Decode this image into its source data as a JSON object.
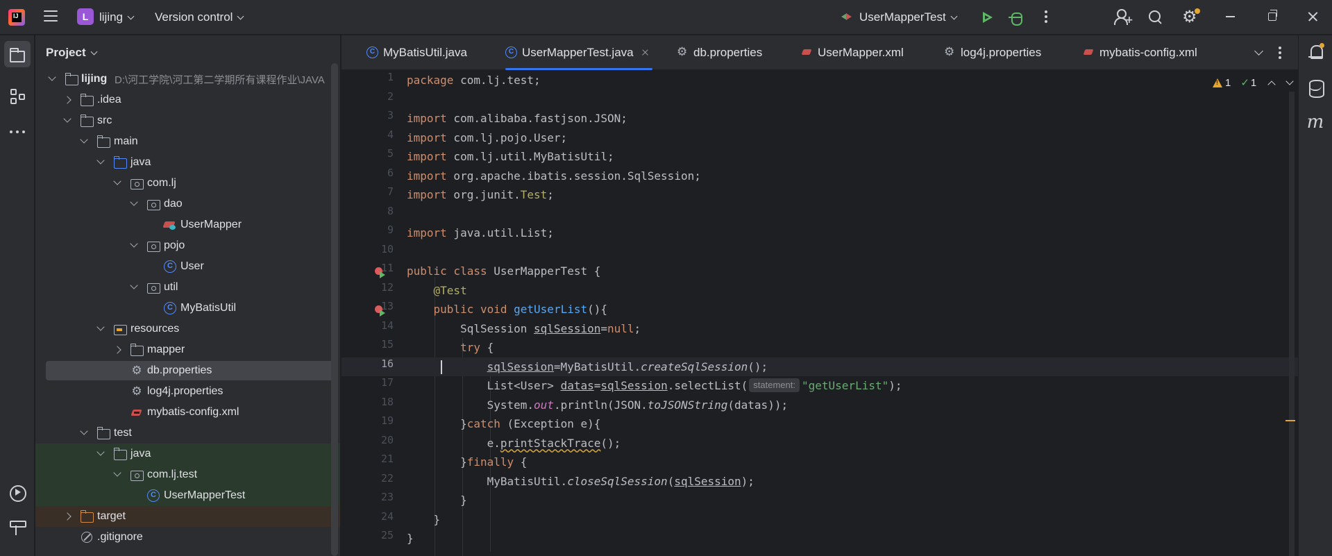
{
  "titlebar": {
    "project_badge": "L",
    "project_name": "lijing",
    "vcs_label": "Version control",
    "run_config": "UserMapperTest",
    "colors": {
      "accent": "#3574f0",
      "run": "#5fb865",
      "badge": "#9b58d6"
    }
  },
  "left_strip": {
    "icons": [
      "project-folder-icon",
      "structure-icon",
      "more-icon",
      "services-icon",
      "build-icon"
    ]
  },
  "project_panel": {
    "title": "Project",
    "root_label": "lijing",
    "root_path": "D:\\河工学院\\河工第二学期所有课程作业\\JAVA",
    "items": [
      {
        "label": ".idea"
      },
      {
        "label": "src"
      },
      {
        "label": "main"
      },
      {
        "label": "java"
      },
      {
        "label": "com.lj"
      },
      {
        "label": "dao"
      },
      {
        "label": "UserMapper"
      },
      {
        "label": "pojo"
      },
      {
        "label": "User"
      },
      {
        "label": "util"
      },
      {
        "label": "MyBatisUtil"
      },
      {
        "label": "resources"
      },
      {
        "label": "mapper"
      },
      {
        "label": "db.properties"
      },
      {
        "label": "log4j.properties"
      },
      {
        "label": "mybatis-config.xml"
      },
      {
        "label": "test"
      },
      {
        "label": "java"
      },
      {
        "label": "com.lj.test"
      },
      {
        "label": "UserMapperTest"
      },
      {
        "label": "target"
      },
      {
        "label": ".gitignore"
      }
    ]
  },
  "tabs": [
    {
      "label": "MyBatisUtil.java",
      "icon": "class-icon"
    },
    {
      "label": "UserMapperTest.java",
      "icon": "class-icon",
      "active": true
    },
    {
      "label": "db.properties",
      "icon": "gear-icon"
    },
    {
      "label": "UserMapper.xml",
      "icon": "xml-icon"
    },
    {
      "label": "log4j.properties",
      "icon": "gear-icon"
    },
    {
      "label": "mybatis-config.xml",
      "icon": "xml-icon"
    }
  ],
  "editor": {
    "warnings_count": "1",
    "ok_count": "1",
    "current_line": 16,
    "line_numbers": [
      "1",
      "2",
      "3",
      "4",
      "5",
      "6",
      "7",
      "8",
      "9",
      "10",
      "11",
      "12",
      "13",
      "14",
      "15",
      "16",
      "17",
      "18",
      "19",
      "20",
      "21",
      "22",
      "23",
      "24",
      "25"
    ],
    "param_hint": "statement:"
  }
}
